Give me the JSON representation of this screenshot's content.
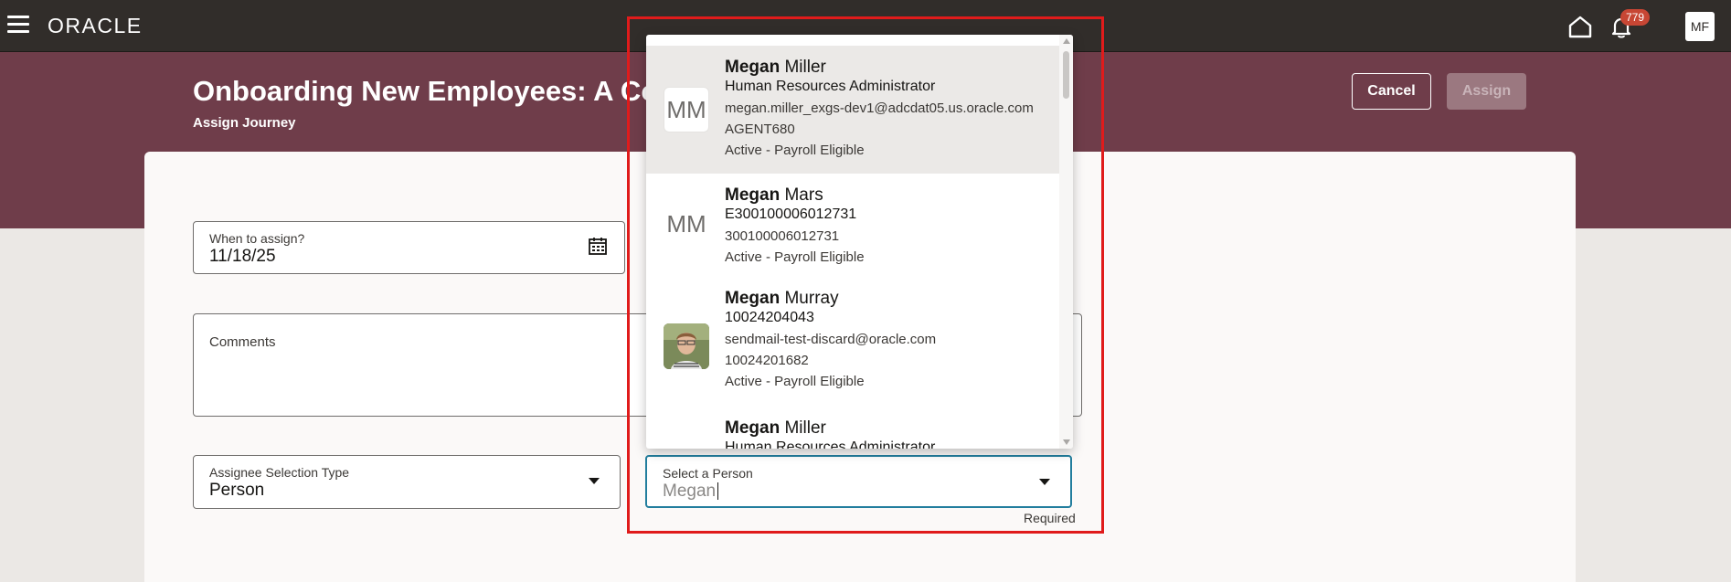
{
  "topbar": {
    "logo": "ORACLE",
    "notifications_count": "779",
    "user_initials": "MF"
  },
  "header": {
    "title": "Onboarding New Employees: A Co",
    "subtitle": "Assign Journey",
    "cancel_label": "Cancel",
    "assign_label": "Assign"
  },
  "form": {
    "when": {
      "label": "When to assign?",
      "value": "11/18/25"
    },
    "comments": {
      "label": "Comments",
      "value": ""
    },
    "assignee_type": {
      "label": "Assignee Selection Type",
      "value": "Person"
    },
    "select_person": {
      "label": "Select a Person",
      "value": "Megan",
      "required_text": "Required"
    }
  },
  "dropdown": {
    "items": [
      {
        "initials": "MM",
        "first": "Megan",
        "last": "Miller",
        "line1": "Human Resources Administrator",
        "line2": "megan.miller_exgs-dev1@adcdat05.us.oracle.com",
        "line3": "AGENT680",
        "line4": "Active - Payroll Eligible"
      },
      {
        "initials": "MM",
        "first": "Megan",
        "last": "Mars",
        "line1": "E300100006012731",
        "line2": "300100006012731",
        "line3": "Active - Payroll Eligible"
      },
      {
        "first": "Megan",
        "last": "Murray",
        "line1": "10024204043",
        "line2": "sendmail-test-discard@oracle.com",
        "line3": "10024201682",
        "line4": "Active - Payroll Eligible"
      },
      {
        "first": "Megan",
        "last": "Miller",
        "line1": "Human Resources Administrator"
      }
    ]
  }
}
